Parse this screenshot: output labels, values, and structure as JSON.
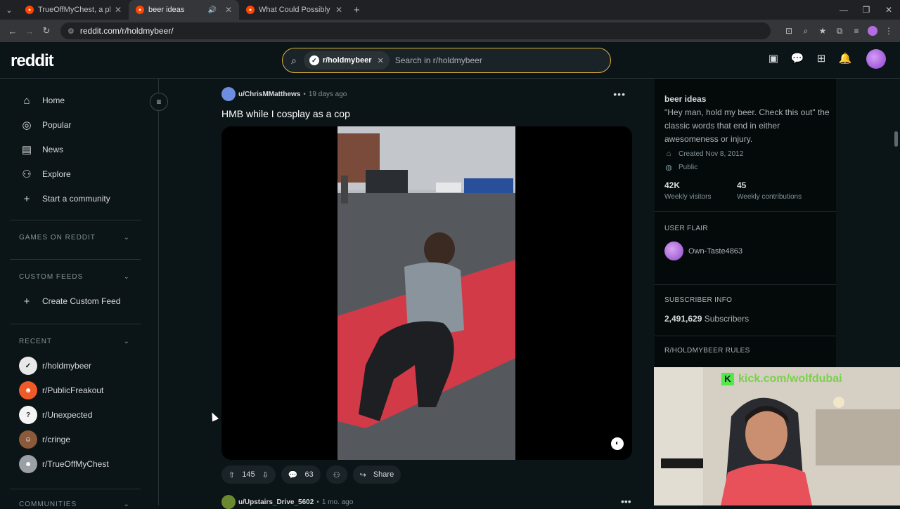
{
  "browser": {
    "tabs": [
      {
        "title": "TrueOffMyChest, a place for pe"
      },
      {
        "title": "beer ideas"
      },
      {
        "title": "What Could Possibly Go Wrong"
      }
    ],
    "url": "reddit.com/r/holdmybeer/"
  },
  "header": {
    "logo": "reddit",
    "search_chip": "r/holdmybeer",
    "search_placeholder": "Search in r/holdmybeer"
  },
  "sidebar": {
    "nav": [
      {
        "label": "Home",
        "icon": "home-icon"
      },
      {
        "label": "Popular",
        "icon": "popular-icon"
      },
      {
        "label": "News",
        "icon": "news-icon"
      },
      {
        "label": "Explore",
        "icon": "explore-icon"
      },
      {
        "label": "Start a community",
        "icon": "plus-icon"
      }
    ],
    "games_title": "GAMES ON REDDIT",
    "custom_feeds_title": "CUSTOM FEEDS",
    "create_feed": "Create Custom Feed",
    "recent_title": "RECENT",
    "recent": [
      {
        "label": "r/holdmybeer",
        "color": "#e8e8e8"
      },
      {
        "label": "r/PublicFreakout",
        "color": "#f05a28"
      },
      {
        "label": "r/Unexpected",
        "color": "#f4f4f4"
      },
      {
        "label": "r/cringe",
        "color": "#8a5a3a"
      },
      {
        "label": "r/TrueOffMyChest",
        "color": "#9aa0a6"
      }
    ],
    "communities_title": "COMMUNITIES"
  },
  "post": {
    "author": "u/ChrisMMatthews",
    "age": "19 days ago",
    "title": "HMB while I cosplay as a cop",
    "votes": "145",
    "comments": "63",
    "share": "Share"
  },
  "next_post": {
    "author": "u/Upstairs_Drive_5602",
    "age": "1 mo. ago"
  },
  "community": {
    "title": "beer ideas",
    "description": "\"Hey man, hold my beer. Check this out\" the classic words that end in either awesomeness or injury.",
    "created": "Created Nov 8, 2012",
    "visibility": "Public",
    "visitors_value": "42K",
    "visitors_label": "Weekly visitors",
    "contrib_value": "45",
    "contrib_label": "Weekly contributions",
    "user_flair_title": "USER FLAIR",
    "flair_user": "Own-Taste4863",
    "subscriber_title": "SUBSCRIBER INFO",
    "subscribers": "2,491,629",
    "subscribers_label": "Subscribers",
    "rules_title": "R/HOLDMYBEER RULES"
  },
  "overlay": {
    "webcam_text": "kick.com/wolfdubai"
  }
}
